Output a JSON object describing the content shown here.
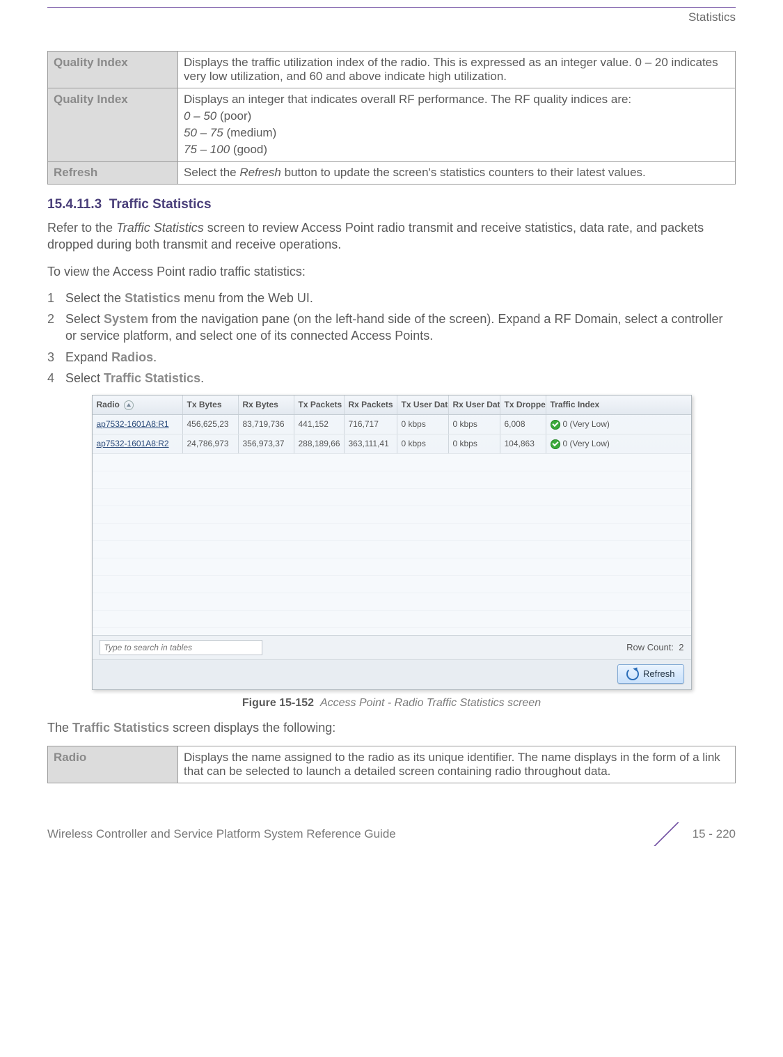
{
  "header": {
    "section": "Statistics"
  },
  "table1": {
    "rows": [
      {
        "label": "Quality Index",
        "desc": "Displays the traffic utilization index of the radio. This is expressed as an integer value. 0 – 20 indicates very low utilization, and 60 and above indicate high utilization."
      },
      {
        "label": "Quality Index",
        "desc_intro": "Displays an integer that indicates overall RF performance. The RF quality indices are:",
        "scales": [
          {
            "range": "0 – 50",
            "label": " (poor)"
          },
          {
            "range": "50 – 75",
            "label": " (medium)"
          },
          {
            "range": "75 – 100",
            "label": " (good)"
          }
        ]
      },
      {
        "label": "Refresh",
        "desc_pre": "Select the ",
        "desc_em": "Refresh",
        "desc_post": " button to update the screen's statistics counters to their latest values."
      }
    ]
  },
  "section": {
    "num": "15.4.11.3",
    "title": "Traffic Statistics",
    "intro_pre": "Refer to the ",
    "intro_em": "Traffic Statistics",
    "intro_post": " screen to review Access Point radio transmit and receive statistics, data rate, and packets dropped during both transmit and receive operations.",
    "lead": "To view the Access Point radio traffic statistics:",
    "steps": [
      {
        "n": "1",
        "pre": "Select the ",
        "bold": "Statistics",
        "post": " menu from the Web UI."
      },
      {
        "n": "2",
        "pre": "Select ",
        "bold": "System",
        "post": " from the navigation pane (on the left-hand side of the screen). Expand a RF Domain, select a controller or service platform, and select one of its connected Access Points."
      },
      {
        "n": "3",
        "pre": "Expand ",
        "bold": "Radios",
        "post": "."
      },
      {
        "n": "4",
        "pre": "Select ",
        "bold": "Traffic Statistics",
        "post": "."
      }
    ],
    "after_shot_pre": "The ",
    "after_shot_bold": "Traffic Statistics",
    "after_shot_post": " screen displays the following:"
  },
  "screenshot": {
    "headers": {
      "radio": "Radio",
      "txb": "Tx Bytes",
      "rxb": "Rx Bytes",
      "txp": "Tx Packets",
      "rxp": "Rx Packets",
      "txu": "Tx User Data Rate",
      "rxu": "Rx User Data Rate",
      "txd": "Tx Dropped",
      "ti": "Traffic Index"
    },
    "rows": [
      {
        "radio": "ap7532-1601A8:R1",
        "txb": "456,625,23",
        "rxb": "83,719,736",
        "txp": "441,152",
        "rxp": "716,717",
        "txu": "0 kbps",
        "rxu": "0 kbps",
        "txd": "6,008",
        "ti": "0 (Very Low)"
      },
      {
        "radio": "ap7532-1601A8:R2",
        "txb": "24,786,973",
        "rxb": "356,973,37",
        "txp": "288,189,66",
        "rxp": "363,111,41",
        "txu": "0 kbps",
        "rxu": "0 kbps",
        "txd": "104,863",
        "ti": "0 (Very Low)"
      }
    ],
    "search_placeholder": "Type to search in tables",
    "row_count_label": "Row Count:",
    "row_count_value": "2",
    "refresh_label": "Refresh"
  },
  "figure": {
    "num": "Figure 15-152",
    "caption": "Access Point - Radio Traffic Statistics screen"
  },
  "table2": {
    "rows": [
      {
        "label": "Radio",
        "desc": "Displays the name assigned to the radio as its unique identifier. The name displays in the form of a link that can be selected to launch a detailed screen containing radio throughout data."
      }
    ]
  },
  "footer": {
    "left": "Wireless Controller and Service Platform System Reference Guide",
    "right": "15 - 220"
  }
}
